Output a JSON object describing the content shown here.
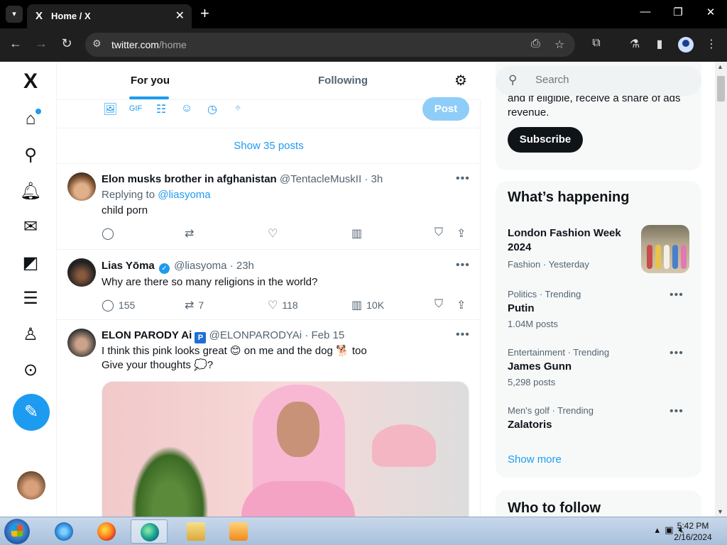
{
  "browser": {
    "tab_title": "Home / X",
    "tab_favicon": "X",
    "url_host": "twitter.com",
    "url_path": "/home"
  },
  "leftnav": {
    "logo": "X",
    "icons": [
      "home-icon",
      "search-icon",
      "bell-icon",
      "mail-icon",
      "grok-icon",
      "lists-icon",
      "profile-icon",
      "more-icon"
    ]
  },
  "center": {
    "tabs": [
      {
        "label": "For you",
        "active": true
      },
      {
        "label": "Following",
        "active": false
      }
    ],
    "post_button": "Post",
    "show_posts": "Show 35 posts",
    "posts": [
      {
        "name": "Elon musks brother in afghanistan",
        "handle": "@TentacleMuskII",
        "time": "3h",
        "reply_prefix": "Replying to",
        "reply_to": "@liasyoma",
        "text": "child porn",
        "replies": "",
        "reposts": "",
        "likes": "",
        "views": ""
      },
      {
        "name": "Lias Yōma",
        "handle": "@liasyoma",
        "time": "23h",
        "text": "Why are there so many religions in the world?",
        "verified": true,
        "replies": "155",
        "reposts": "7",
        "likes": "118",
        "views": "10K"
      },
      {
        "name": "ELON PARODY Ai",
        "badge": "P",
        "handle": "@ELONPARODYAi",
        "time": "Feb 15",
        "text_line1": "I think this pink looks great 😊 on me and the dog 🐕 too",
        "text_line2": "Give your thoughts 💭?"
      }
    ]
  },
  "right": {
    "search_placeholder": "Search",
    "premium_text": "and if eligible, receive a share of ads revenue.",
    "subscribe": "Subscribe",
    "whats_happening": "What’s happening",
    "trends": [
      {
        "category": "",
        "name": "London Fashion Week 2024",
        "count": "Fashion · Yesterday"
      },
      {
        "category": "Politics · Trending",
        "name": "Putin",
        "count": "1.04M posts"
      },
      {
        "category": "Entertainment · Trending",
        "name": "James Gunn",
        "count": "5,298 posts"
      },
      {
        "category": "Men's golf · Trending",
        "name": "Zalatoris",
        "count": ""
      }
    ],
    "show_more": "Show more",
    "who_to_follow": "Who to follow"
  },
  "taskbar": {
    "time": "5:42 PM",
    "date": "2/16/2024"
  },
  "colors": {
    "accent": "#1d9bf0",
    "text": "#0f1419",
    "muted": "#536471"
  }
}
